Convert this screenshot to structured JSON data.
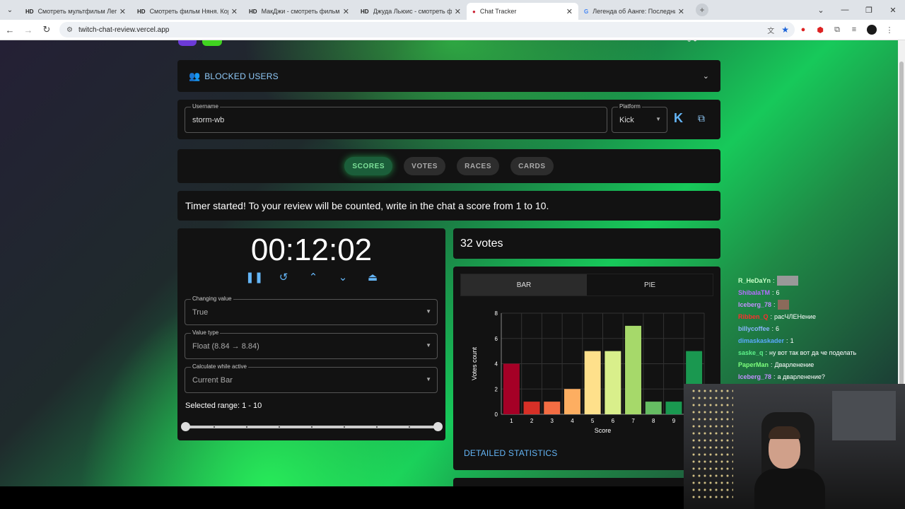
{
  "browser": {
    "tabs": [
      {
        "fav": "HD",
        "label": "Смотреть мультфильм Легенд",
        "active": false
      },
      {
        "fav": "HD",
        "label": "Смотреть фильм Няня. Корол",
        "active": false
      },
      {
        "fav": "HD",
        "label": "МакДжи - смотреть фильмы",
        "active": false
      },
      {
        "fav": "HD",
        "label": "Джуда Льюис - смотреть фил",
        "active": false
      },
      {
        "fav": "●",
        "label": "Chat Tracker",
        "active": true
      },
      {
        "fav": "G",
        "label": "Легенда об Аанге: Последний",
        "active": false
      }
    ],
    "url": "twitch-chat-review.vercel.app"
  },
  "blocked_users": {
    "label": "BLOCKED USERS"
  },
  "user": {
    "username_label": "Username",
    "username_value": "storm-wb",
    "platform_label": "Platform",
    "platform_value": "Kick"
  },
  "mode_tabs": [
    "SCORES",
    "VOTES",
    "RACES",
    "CARDS"
  ],
  "active_mode": 0,
  "message": "Timer started! To your review will be counted, write in the chat a score from 1 to 10.",
  "timer": {
    "time": "00:12:02",
    "changing_value_label": "Changing value",
    "changing_value": "True",
    "value_type_label": "Value type",
    "value_type": "Float (8.84 → 8.84)",
    "calc_label": "Calculate while active",
    "calc_value": "Current Bar",
    "range_label": "Selected range: 1 - 10",
    "range_min": 1,
    "range_max": 10
  },
  "votes_label": "32 votes",
  "chart_tabs": {
    "bar": "BAR",
    "pie": "PIE"
  },
  "detailed_label": "DETAILED STATISTICS",
  "chart_data": {
    "type": "bar",
    "categories": [
      "1",
      "2",
      "3",
      "4",
      "5",
      "6",
      "7",
      "8",
      "9",
      "10"
    ],
    "values": [
      4,
      1,
      1,
      2,
      5,
      5,
      7,
      1,
      1,
      5
    ],
    "xlabel": "Score",
    "ylabel": "Votes count",
    "ylim": [
      0,
      8
    ],
    "yticks": [
      0,
      2,
      4,
      6,
      8
    ],
    "grid": true,
    "colors": [
      "#a50026",
      "#d73027",
      "#f46d43",
      "#fdae61",
      "#fee08b",
      "#d9ef8b",
      "#a6d96a",
      "#66bd63",
      "#1a9850",
      "#1a9850"
    ]
  },
  "chat": [
    {
      "user": "R_HeDaYn",
      "color": "#c8ffc8",
      "text": "",
      "emote": "w"
    },
    {
      "user": "ShibalaTM",
      "color": "#b66dff",
      "text": "6"
    },
    {
      "user": "Iceberg_78",
      "color": "#c390ff",
      "text": "",
      "emote": "s"
    },
    {
      "user": "Ribben_Q",
      "color": "#ff2d2d",
      "text": "расЧЛЕНение"
    },
    {
      "user": "billycoffee",
      "color": "#8ab4ff",
      "text": "6"
    },
    {
      "user": "dimaskaskader",
      "color": "#5aa9ff",
      "text": "1"
    },
    {
      "user": "saske_q",
      "color": "#5ef28a",
      "text": "ну вот так вот да че поделать"
    },
    {
      "user": "PaperMan",
      "color": "#7dff7d",
      "text": "Дварленение"
    },
    {
      "user": "Iceberg_78",
      "color": "#c390ff",
      "text": "а дварленение?"
    }
  ]
}
